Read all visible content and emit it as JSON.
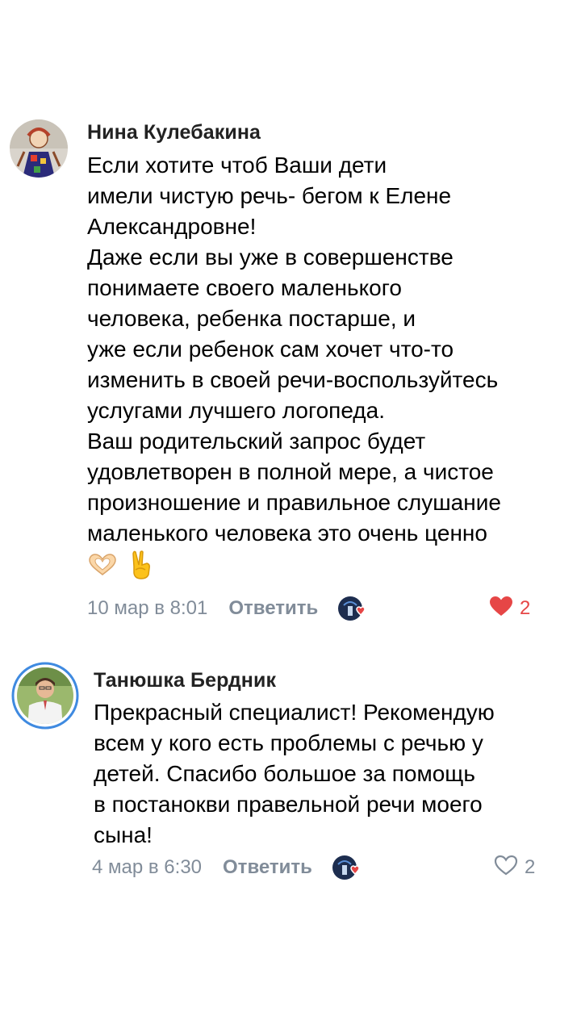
{
  "comments": [
    {
      "author": "Нина Кулебакина",
      "lines": [
        "Если хотите чтоб Ваши дети",
        "имели чистую речь- бегом к Елене",
        "Александровне!",
        "Даже если вы уже в совершенстве",
        "понимаете своего маленького",
        "человека, ребенка постарше, и",
        "уже если ребенок сам хочет что-то",
        "изменить в своей речи-воспользуйтесь",
        "услугами лучшего логопеда.",
        "Ваш родительский запрос будет",
        "удовлетворен в полной мере, а чистое",
        "произношение и правильное слушание",
        "маленького человека это очень ценно"
      ],
      "emojis": [
        "heart-hands-icon",
        "victory-hand-icon"
      ],
      "date": "10 мар в 8:01",
      "reply_label": "Ответить",
      "likes": "2",
      "liked": true
    },
    {
      "author": "Танюшка Бердник",
      "lines": [
        "Прекрасный специалист! Рекомендую",
        "всем у кого есть проблемы с речью у",
        "детей. Спасибо большое за помощь",
        "в постанокви правельной речи моего",
        "сына!"
      ],
      "date": "4 мар в 6:30",
      "reply_label": "Ответить",
      "likes": "2",
      "liked": false
    }
  ],
  "colors": {
    "meta_gray": "#818c99",
    "like_red": "#e64646",
    "avatar_ring_blue": "#3f8ae0"
  }
}
